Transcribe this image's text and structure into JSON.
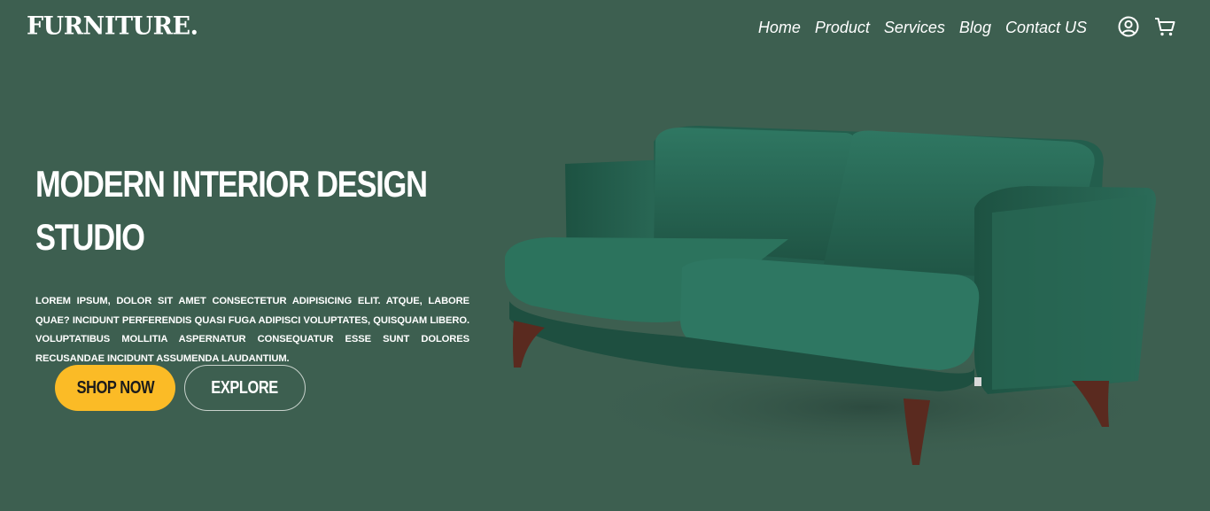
{
  "header": {
    "logo": "FURNITURE.",
    "nav": [
      "Home",
      "Product",
      "Services",
      "Blog",
      "Contact US"
    ],
    "icons": [
      "user-icon",
      "cart-icon"
    ]
  },
  "hero": {
    "title": "Modern Interior Design Studio",
    "description": "Lorem ipsum, dolor sit amet consectetur adipisicing elit. Atque, labore quae? Incidunt perferendis quasi fuga adipisci voluptates, quisquam libero. Voluptatibus mollitia aspernatur consequatur esse sunt dolores recusandae incidunt assumenda laudantium.",
    "primary_button": "Shop Now",
    "secondary_button": "Explore",
    "image": "green-velvet-sofa"
  },
  "colors": {
    "background": "#3d5f50",
    "accent": "#fbbb26",
    "sofa": "#2b6b58"
  }
}
